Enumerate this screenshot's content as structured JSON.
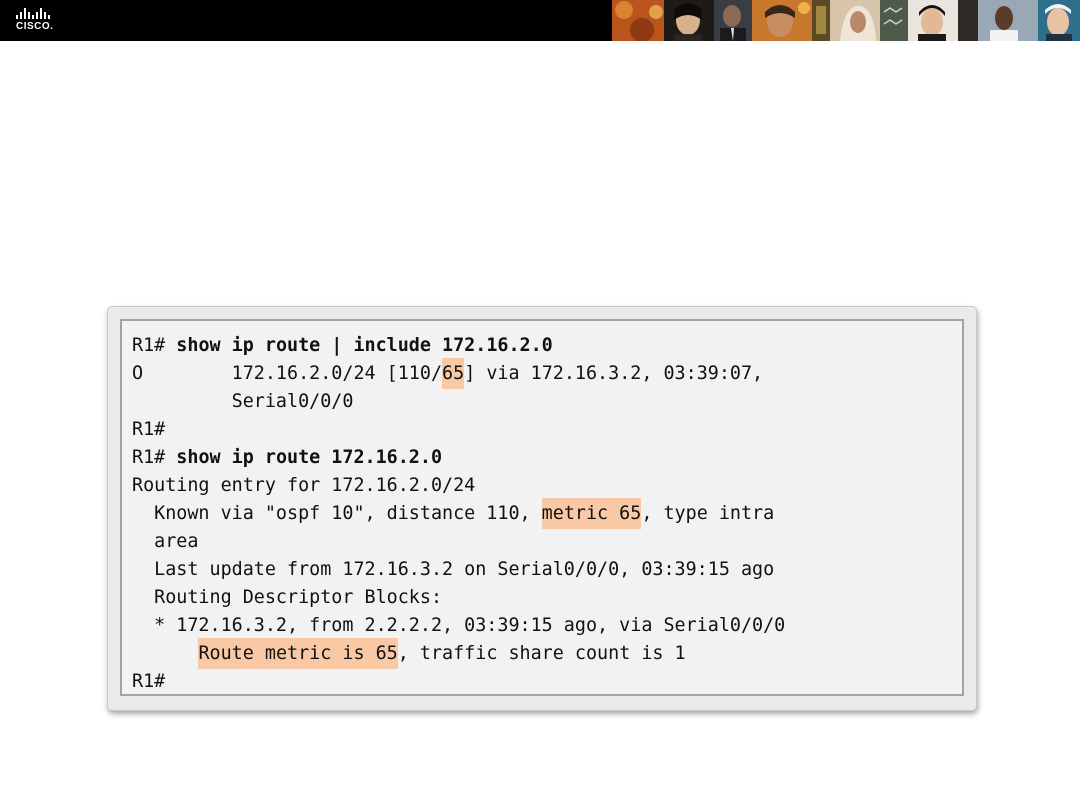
{
  "header": {
    "logo_text": "CISCO."
  },
  "terminal": {
    "lines": [
      {
        "a": "R1# ",
        "cmd": "show ip route | include 172.16.2.0"
      },
      {
        "a": "O        172.16.2.0/24 [110/",
        "hl": "65",
        "b": "] via 172.16.3.2, 03:39:07,"
      },
      {
        "a": "         Serial0/0/0"
      },
      {
        "a": "R1#"
      },
      {
        "a": "R1# ",
        "cmd": "show ip route 172.16.2.0"
      },
      {
        "a": "Routing entry for 172.16.2.0/24"
      },
      {
        "a": "  Known via \"ospf 10\", distance 110, ",
        "hl": "metric 65",
        "b": ", type intra"
      },
      {
        "a": "  area"
      },
      {
        "a": "  Last update from 172.16.3.2 on Serial0/0/0, 03:39:15 ago"
      },
      {
        "a": "  Routing Descriptor Blocks:"
      },
      {
        "a": "  * 172.16.3.2, from 2.2.2.2, 03:39:15 ago, via Serial0/0/0"
      },
      {
        "a": "      ",
        "hl": "Route metric is 65",
        "b": ", traffic share count is 1"
      },
      {
        "a": "R1#"
      }
    ]
  }
}
